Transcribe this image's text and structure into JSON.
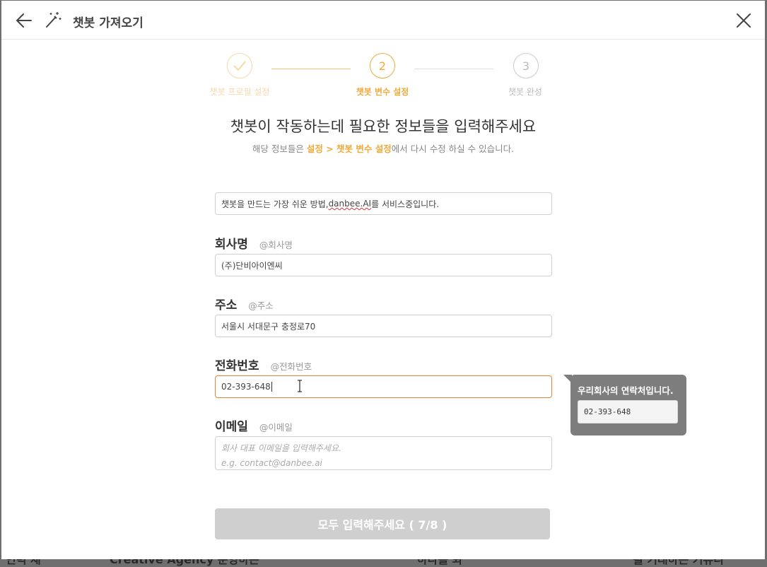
{
  "header": {
    "title": "챗봇 가져오기"
  },
  "stepper": {
    "steps": [
      {
        "label": "챗봇 프로필 설정",
        "number": "",
        "state": "done"
      },
      {
        "label": "챗봇 변수 설정",
        "number": "2",
        "state": "active"
      },
      {
        "label": "챗봇 완성",
        "number": "3",
        "state": "pending"
      }
    ]
  },
  "intro": {
    "title": "챗봇이 작동하는데 필요한 정보들을 입력해주세요",
    "subtitle_pre": "해당 정보들은 ",
    "subtitle_link": "설정 > 챗봇 변수 설정",
    "subtitle_post": "에서 다시 수정 하실 수 있습니다."
  },
  "fields": {
    "intro_value_pre": "챗봇을 만드는 가장 쉬운 방법, ",
    "intro_value_word": "danbee.AI",
    "intro_value_post": "를 서비스중입니다.",
    "company": {
      "label": "회사명",
      "var": "@회사명",
      "value": "(주)단비아이엔씨"
    },
    "address": {
      "label": "주소",
      "var": "@주소",
      "value": "서울시 서대문구 충정로70"
    },
    "phone": {
      "label": "전화번호",
      "var": "@전화번호",
      "value": "02-393-648"
    },
    "email": {
      "label": "이메일",
      "var": "@이메일",
      "placeholder_line1": "회사 대표 이메일을 입력해주세요.",
      "placeholder_line2": "e.g. contact@danbee.ai"
    }
  },
  "tooltip": {
    "title": "우리회사의 연락처입니다.",
    "preview": "02-393-648"
  },
  "submit": {
    "label": "모두 입력해주세요 ( 7/8 )"
  },
  "colors": {
    "accent": "#f2a93b",
    "active_border": "#e0863a",
    "disabled": "#cfcfcf"
  }
}
